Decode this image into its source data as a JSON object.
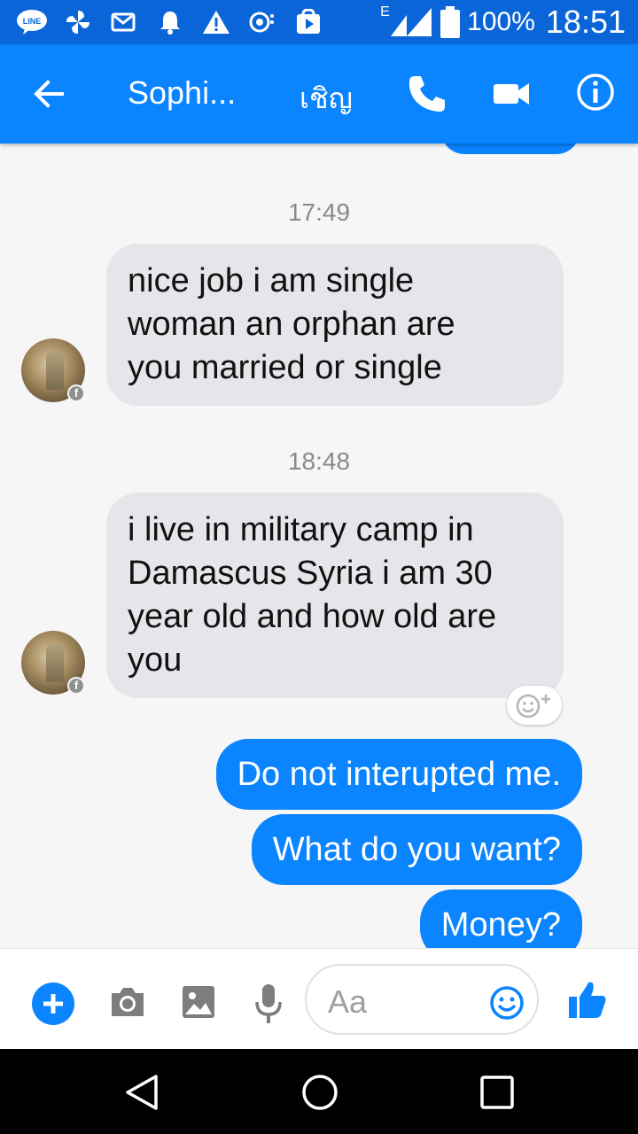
{
  "status_bar": {
    "battery_text": "100%",
    "time": "18:51",
    "network_type": "E",
    "notification_icons": [
      "line-icon",
      "pinwheel-icon",
      "mail-icon",
      "bell-icon",
      "warning-icon",
      "mesh-icon",
      "play-store-icon"
    ]
  },
  "header": {
    "contact_name": "Sophi...",
    "chip_label": "เชิญ",
    "colors": {
      "bar": "#0a84ff",
      "status_bar": "#0a66d8"
    }
  },
  "messages": {
    "timestamp_1": "17:49",
    "incoming_1": {
      "line_1": "nice job i am single",
      "line_2": "woman an orphan are",
      "line_3": "you married or single"
    },
    "timestamp_2": "18:48",
    "incoming_2": {
      "line_1": "i live in military camp in",
      "line_2": "Damascus Syria  i am 30",
      "line_3": "year old and how old are",
      "line_4": "you"
    },
    "outgoing_1": "Do not interupted me.",
    "outgoing_2": "What do you want?",
    "outgoing_3": "Money?",
    "colors": {
      "outgoing": "#0a84ff",
      "incoming": "#e5e5ea"
    }
  },
  "composer": {
    "placeholder": "Aa"
  },
  "badge": {
    "facebook_letter": "f"
  }
}
